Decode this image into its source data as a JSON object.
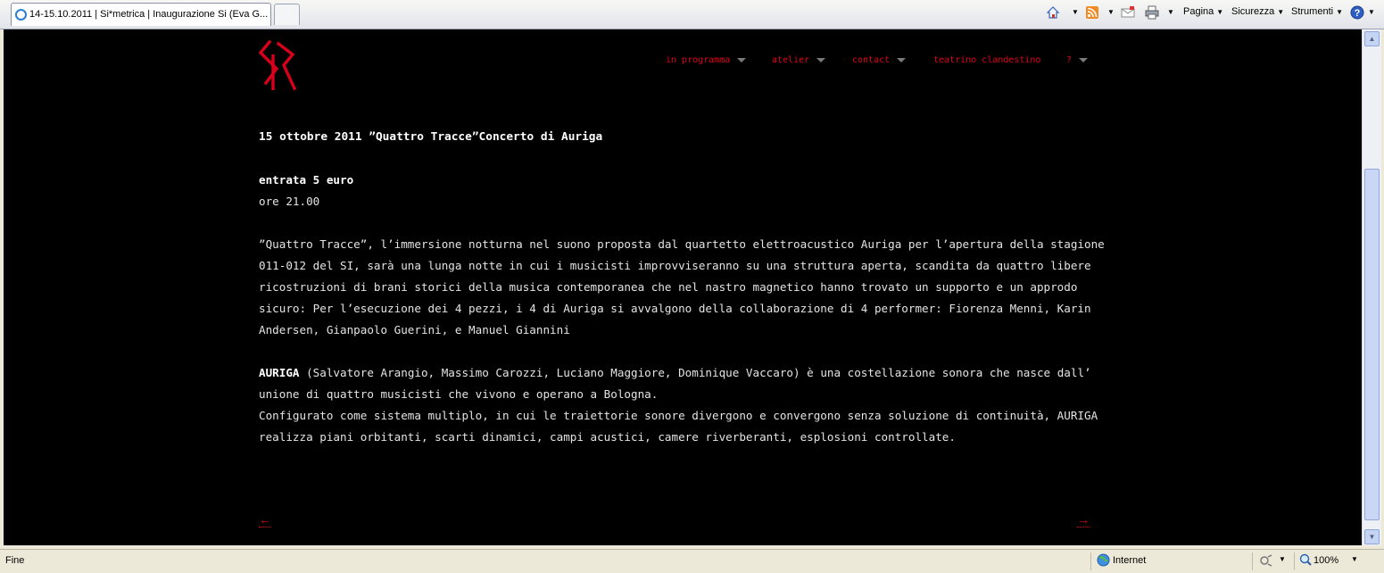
{
  "browser": {
    "tab_title": "14-15.10.2011 | Si*metrica | Inaugurazione Si (Eva G...",
    "tools": {
      "pagina": "Pagina",
      "sicurezza": "Sicurezza",
      "strumenti": "Strumenti"
    },
    "status": {
      "left": "Fine",
      "zone": "Internet",
      "zoom": "100%"
    }
  },
  "site": {
    "nav": {
      "in_programma": "in programma",
      "atelier": "atelier",
      "contact": "contact",
      "teatrino": "teatrino clandestino",
      "question": "?"
    },
    "heading": "15 ottobre 2011 ”Quattro Tracce”Concerto di Auriga",
    "entry": "entrata 5 euro",
    "time": "ore 21.00",
    "para1": "”Quattro Tracce”, l’immersione notturna nel suono proposta dal quartetto elettroacustico Auriga per l’apertura della stagione 011-012 del SI, sarà una lunga notte in cui i musicisti improvviseranno su una struttura aperta, scandita da quattro libere ricostruzioni di brani storici della musica contemporanea che nel nastro magnetico hanno trovato un supporto e un approdo sicuro: Per l’esecuzione dei 4 pezzi, i 4 di Auriga si avvalgono della collaborazione di 4 performer: Fiorenza Menni, Karin Andersen, Gianpaolo Guerini, e Manuel Giannini",
    "auriga_name": "AURIGA",
    "para2_rest": " (Salvatore Arangio, Massimo Carozzi, Luciano Maggiore, Dominique Vaccaro) è una costellazione sonora  che nasce dall’ unione di quattro  musicisti  che vivono e operano a Bologna.",
    "para3": "Configurato come sistema multiplo, in cui le traiettorie sonore divergono e convergono senza soluzione di continuità, AURIGA realizza piani orbitanti, scarti dinamici, campi acustici, camere riverberanti, esplosioni controllate.",
    "prev": "←",
    "next": "→"
  },
  "colors": {
    "accent": "#e10019",
    "background": "#000000",
    "text": "#e4e4e4"
  }
}
